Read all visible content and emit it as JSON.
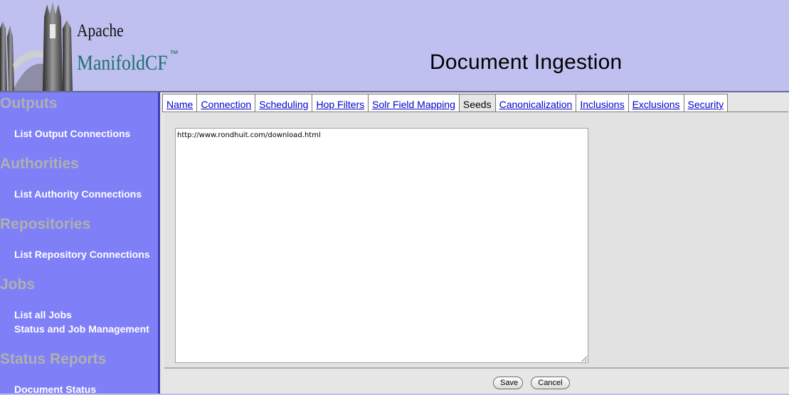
{
  "header": {
    "logo_top": "Apache",
    "logo_product": "ManifoldCF",
    "logo_tm": "™",
    "page_title": "Document Ingestion"
  },
  "sidebar": {
    "sections": [
      {
        "heading": "Outputs",
        "links": [
          "List Output Connections"
        ]
      },
      {
        "heading": "Authorities",
        "links": [
          "List Authority Connections"
        ]
      },
      {
        "heading": "Repositories",
        "links": [
          "List Repository Connections"
        ]
      },
      {
        "heading": "Jobs",
        "links": [
          "List all Jobs",
          "Status and Job Management"
        ]
      },
      {
        "heading": "Status Reports",
        "links": [
          "Document Status"
        ]
      }
    ]
  },
  "tabs": [
    {
      "label": "Name",
      "active": false
    },
    {
      "label": "Connection",
      "active": false
    },
    {
      "label": "Scheduling",
      "active": false
    },
    {
      "label": "Hop Filters",
      "active": false
    },
    {
      "label": "Solr Field Mapping",
      "active": false
    },
    {
      "label": "Seeds",
      "active": true
    },
    {
      "label": "Canonicalization",
      "active": false
    },
    {
      "label": "Inclusions",
      "active": false
    },
    {
      "label": "Exclusions",
      "active": false
    },
    {
      "label": "Security",
      "active": false
    }
  ],
  "seeds": {
    "value": "http://www.rondhuit.com/download.html"
  },
  "buttons": {
    "save": "Save",
    "cancel": "Cancel"
  },
  "colors": {
    "banner_bg": "#c0c0f0",
    "sidebar_bg": "#7f7ff8",
    "tab_link": "#0000cc",
    "logo_teal": "#1e6f72"
  }
}
